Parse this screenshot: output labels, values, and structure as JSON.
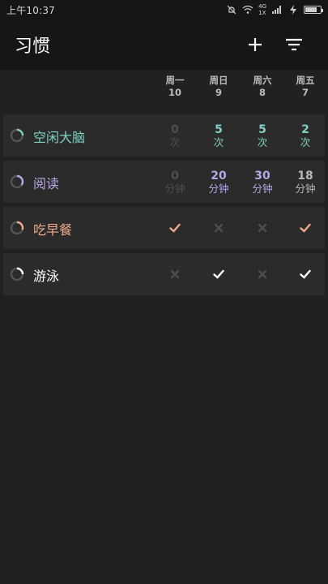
{
  "status": {
    "time": "上午10:37",
    "net_top": "4G",
    "net_bottom": "1X"
  },
  "appbar": {
    "title": "习惯",
    "add_icon": "plus-icon",
    "filter_icon": "filter-icon"
  },
  "days": [
    {
      "weekday": "周一",
      "date": "10"
    },
    {
      "weekday": "周日",
      "date": "9"
    },
    {
      "weekday": "周六",
      "date": "8"
    },
    {
      "weekday": "周五",
      "date": "7"
    }
  ],
  "colors": {
    "teal": "#7fd1c4",
    "purple": "#b8a6e6",
    "orange": "#f0a98c",
    "white": "#ffffff",
    "dim": "#4e4e4e",
    "grey_text": "#b8b8b8"
  },
  "habits": [
    {
      "name": "空闲大脑",
      "color": "#7fd1c4",
      "progress": 0.25,
      "cells": [
        {
          "type": "count",
          "value": "0",
          "unit": "次",
          "active": false
        },
        {
          "type": "count",
          "value": "5",
          "unit": "次",
          "active": true
        },
        {
          "type": "count",
          "value": "5",
          "unit": "次",
          "active": true
        },
        {
          "type": "count",
          "value": "2",
          "unit": "次",
          "active": true
        }
      ]
    },
    {
      "name": "阅读",
      "color": "#b8a6e6",
      "progress": 0.35,
      "cells": [
        {
          "type": "count",
          "value": "0",
          "unit": "分钟",
          "active": false
        },
        {
          "type": "count",
          "value": "20",
          "unit": "分钟",
          "active": true
        },
        {
          "type": "count",
          "value": "30",
          "unit": "分钟",
          "active": true
        },
        {
          "type": "count",
          "value": "18",
          "unit": "分钟",
          "active": "partial"
        }
      ]
    },
    {
      "name": "吃早餐",
      "color": "#f0a98c",
      "progress": 0.3,
      "cells": [
        {
          "type": "check",
          "done": true
        },
        {
          "type": "check",
          "done": false
        },
        {
          "type": "check",
          "done": false
        },
        {
          "type": "check",
          "done": true
        }
      ]
    },
    {
      "name": "游泳",
      "color": "#ffffff",
      "progress": 0.25,
      "cells": [
        {
          "type": "check",
          "done": false
        },
        {
          "type": "check",
          "done": true
        },
        {
          "type": "check",
          "done": false
        },
        {
          "type": "check",
          "done": true
        }
      ]
    }
  ]
}
